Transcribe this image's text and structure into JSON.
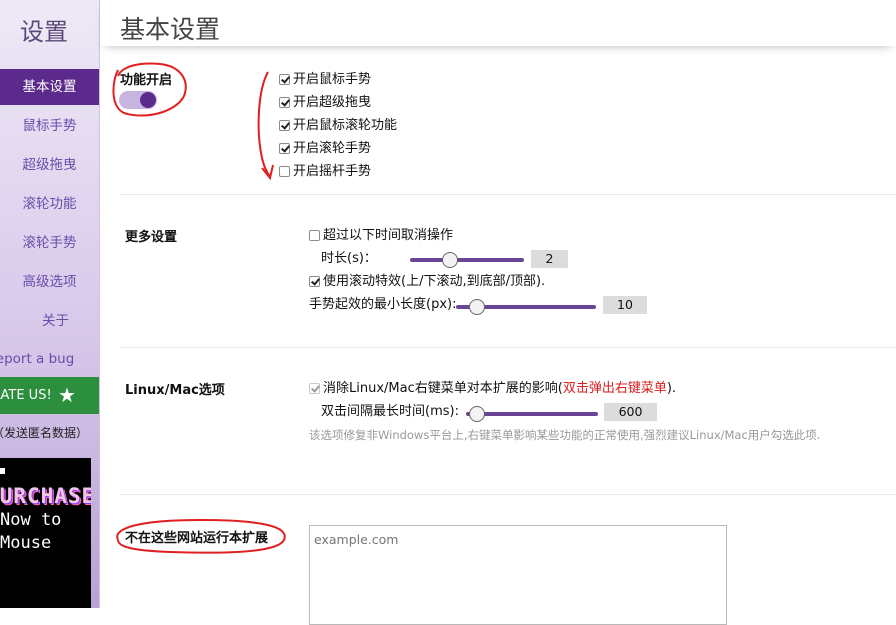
{
  "sidebar": {
    "title": "设置",
    "items": [
      {
        "label": "基本设置",
        "active": true
      },
      {
        "label": "鼠标手势"
      },
      {
        "label": "超级拖曳"
      },
      {
        "label": "滚轮功能"
      },
      {
        "label": "滚轮手势"
      },
      {
        "label": "高级选项"
      },
      {
        "label": "关于"
      },
      {
        "label": "Report a bug"
      }
    ],
    "rate_label": "RATE US!",
    "rate_icon": "star-icon",
    "anon_data": "（发送匿名数据）",
    "ad": {
      "line1": "PURCHASE",
      "line2": "Now to",
      "line3": "Mouse"
    }
  },
  "header": {
    "title": "基本设置"
  },
  "sections": {
    "features": {
      "label": "功能开启",
      "enabled": true,
      "options": [
        {
          "label": "开启鼠标手势",
          "checked": true
        },
        {
          "label": "开启超级拖曳",
          "checked": true
        },
        {
          "label": "开启鼠标滚轮功能",
          "checked": true
        },
        {
          "label": "开启滚轮手势",
          "checked": true
        },
        {
          "label": "开启摇杆手势",
          "checked": false
        }
      ]
    },
    "more": {
      "label": "更多设置",
      "cancel_timeout": {
        "label": "超过以下时间取消操作",
        "checked": false
      },
      "duration": {
        "label": "时长(s)：",
        "value": "2",
        "fraction": 0.35
      },
      "smooth_scroll": {
        "label": "使用滚动特效(上/下滚动,到底部/顶部).",
        "checked": true
      },
      "min_length": {
        "label": "手势起效的最小长度(px):",
        "value": "10",
        "fraction": 0.15
      }
    },
    "linux": {
      "label": "Linux/Mac选项",
      "option_prefix": "消除Linux/Mac右键菜单对本扩展的影响(",
      "option_highlight": "双击弹出右键菜单",
      "option_suffix": ").",
      "checked": true,
      "dblclick": {
        "label": "双击间隔最长时间(ms):",
        "value": "600",
        "fraction": 0.08
      },
      "hint": "该选项修复非Windows平台上,右键菜单影响某些功能的正常使用,强烈建议Linux/Mac用户勾选此项."
    },
    "exclude": {
      "label": "不在这些网站运行本扩展",
      "placeholder": "example.com"
    }
  },
  "colors": {
    "accent": "#5c2a8c",
    "rate_bg": "#2b8f3e",
    "annotation": "#e02020"
  }
}
